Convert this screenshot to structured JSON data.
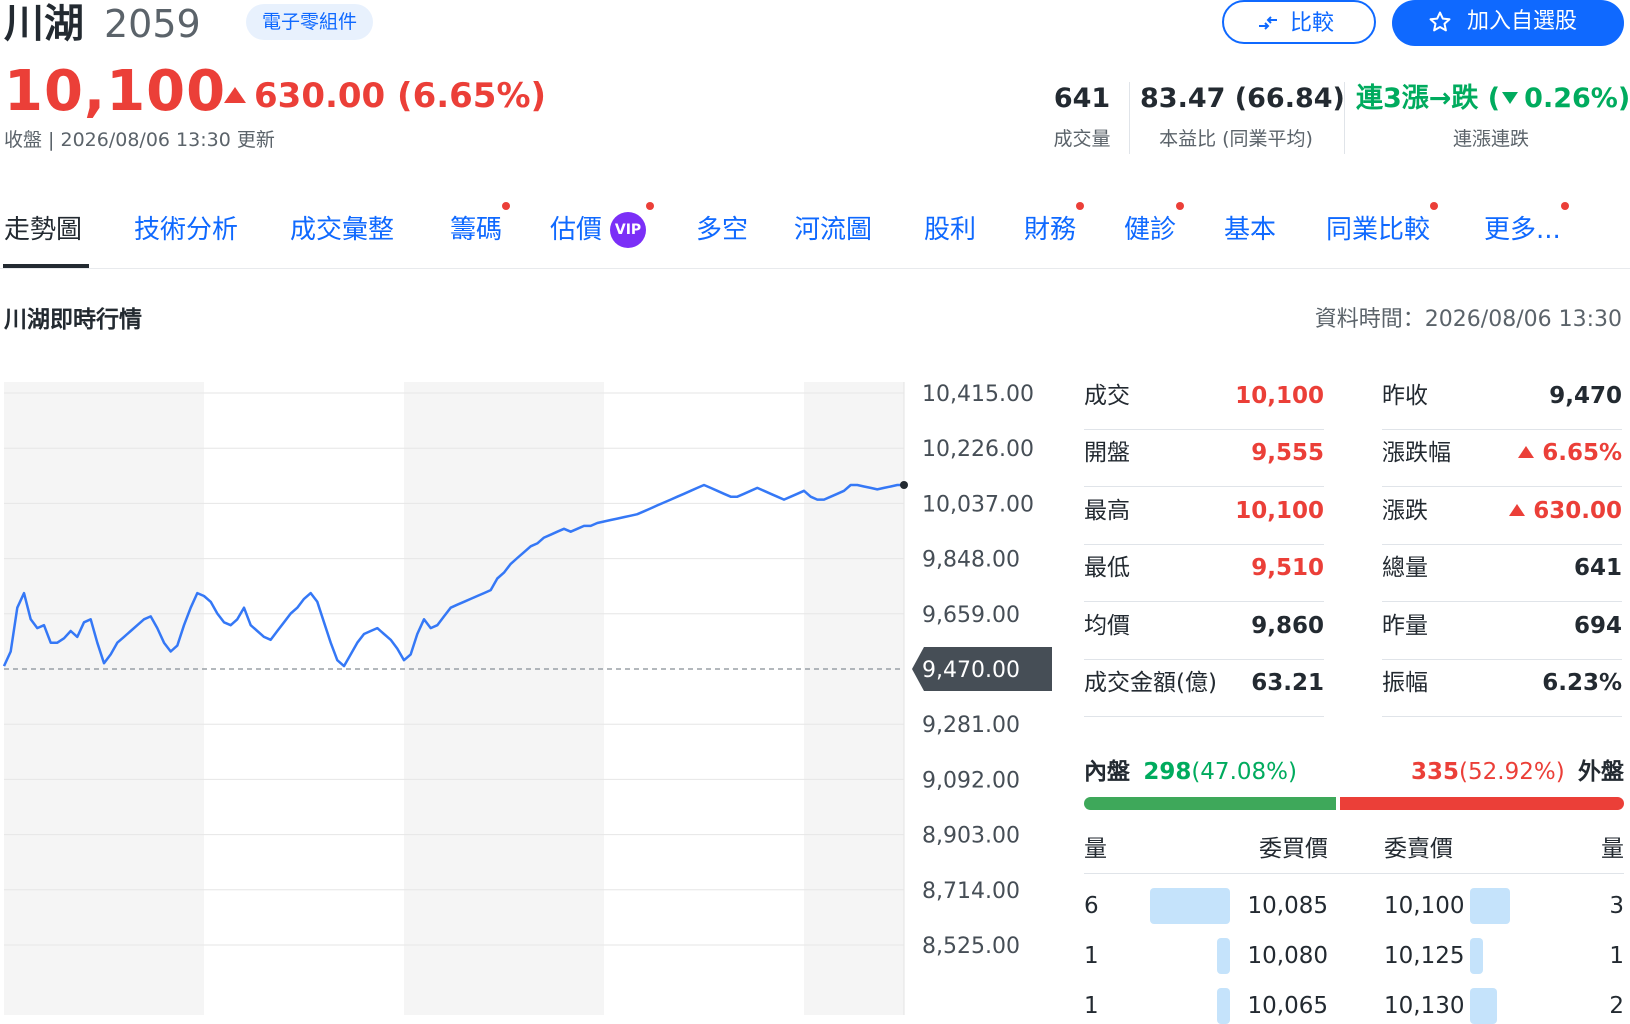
{
  "header": {
    "name": "川湖",
    "code": "2059",
    "industry": "電子零組件",
    "compare_label": "比較",
    "watchlist_label": "加入自選股",
    "price": "10,100",
    "change": "630.00 (6.65%)",
    "close_info": "收盤 | 2026/08/06 13:30 更新"
  },
  "stats": [
    {
      "value": "641",
      "label": "成交量"
    },
    {
      "value": "83.47 (66.84)",
      "label": "本益比 (同業平均)"
    },
    {
      "value_prefix": "連3漲→跌 (",
      "value_mid": "0.26%)",
      "label": "連漲連跌"
    }
  ],
  "tabs": [
    {
      "label": "走勢圖",
      "active": true,
      "dot": false
    },
    {
      "label": "技術分析",
      "dot": false
    },
    {
      "label": "成交彙整",
      "dot": false
    },
    {
      "label": "籌碼",
      "dot": true
    },
    {
      "label": "估價",
      "dot": true,
      "badge": "VIP"
    },
    {
      "label": "多空",
      "dot": false
    },
    {
      "label": "河流圖",
      "dot": false
    },
    {
      "label": "股利",
      "dot": false
    },
    {
      "label": "財務",
      "dot": true
    },
    {
      "label": "健診",
      "dot": true
    },
    {
      "label": "基本",
      "dot": false
    },
    {
      "label": "同業比較",
      "dot": true
    },
    {
      "label": "更多...",
      "dot": true
    }
  ],
  "section": {
    "title": "川湖即時行情",
    "data_time": "資料時間：2026/08/06 13:30"
  },
  "chart_data": {
    "type": "line",
    "y_ticks": [
      "10,415.00",
      "10,226.00",
      "10,037.00",
      "9,848.00",
      "9,659.00",
      "9,470.00",
      "9,281.00",
      "9,092.00",
      "8,903.00",
      "8,714.00",
      "8,525.00"
    ],
    "ylim": [
      8525,
      10415
    ],
    "reference_value": 9470,
    "reference_label": "9,470.00",
    "values": [
      9480,
      9530,
      9680,
      9730,
      9640,
      9610,
      9620,
      9560,
      9560,
      9575,
      9600,
      9580,
      9630,
      9640,
      9560,
      9490,
      9520,
      9560,
      9580,
      9600,
      9620,
      9640,
      9650,
      9610,
      9560,
      9530,
      9550,
      9620,
      9680,
      9730,
      9720,
      9700,
      9660,
      9630,
      9620,
      9640,
      9680,
      9620,
      9600,
      9580,
      9570,
      9600,
      9630,
      9660,
      9680,
      9710,
      9730,
      9700,
      9630,
      9560,
      9500,
      9480,
      9520,
      9560,
      9590,
      9600,
      9610,
      9590,
      9570,
      9540,
      9500,
      9520,
      9590,
      9640,
      9610,
      9620,
      9650,
      9680,
      9690,
      9700,
      9710,
      9720,
      9730,
      9740,
      9780,
      9800,
      9830,
      9850,
      9870,
      9890,
      9900,
      9920,
      9930,
      9940,
      9950,
      9940,
      9950,
      9960,
      9960,
      9970,
      9975,
      9980,
      9985,
      9990,
      9995,
      10000,
      10010,
      10020,
      10030,
      10040,
      10050,
      10060,
      10070,
      10080,
      10090,
      10100,
      10090,
      10080,
      10070,
      10060,
      10060,
      10070,
      10080,
      10090,
      10080,
      10070,
      10060,
      10050,
      10060,
      10070,
      10080,
      10060,
      10050,
      10050,
      10060,
      10070,
      10080,
      10100,
      10100,
      10095,
      10090,
      10085,
      10090,
      10095,
      10100,
      10100
    ],
    "total_slots": 270
  },
  "quote": {
    "left": [
      {
        "label": "成交",
        "value": "10,100",
        "color": "red"
      },
      {
        "label": "開盤",
        "value": "9,555",
        "color": "red"
      },
      {
        "label": "最高",
        "value": "10,100",
        "color": "red"
      },
      {
        "label": "最低",
        "value": "9,510",
        "color": "red"
      },
      {
        "label": "均價",
        "value": "9,860",
        "color": "dark"
      },
      {
        "label": "成交金額(億)",
        "value": "63.21",
        "color": "dark"
      }
    ],
    "right": [
      {
        "label": "昨收",
        "value": "9,470",
        "color": "dark"
      },
      {
        "label": "漲跌幅",
        "value": "6.65%",
        "color": "red",
        "arrow": true
      },
      {
        "label": "漲跌",
        "value": "630.00",
        "color": "red",
        "arrow": true
      },
      {
        "label": "總量",
        "value": "641",
        "color": "dark"
      },
      {
        "label": "昨量",
        "value": "694",
        "color": "dark"
      },
      {
        "label": "振幅",
        "value": "6.23%",
        "color": "dark"
      }
    ]
  },
  "inner_outer": {
    "inner_label": "內盤",
    "inner_value": "298",
    "inner_pct": "(47.08%)",
    "inner_fraction": 0.4708,
    "outer_value": "335",
    "outer_pct": "(52.92%)",
    "outer_label": "外盤"
  },
  "order_book": {
    "headers": [
      "量",
      "委買價",
      "委賣價",
      "量"
    ],
    "rows": [
      {
        "bid_qty": "6",
        "bid_price": "10,085",
        "ask_price": "10,100",
        "ask_qty": "3",
        "bid_fraction": 1.0,
        "ask_fraction": 0.5
      },
      {
        "bid_qty": "1",
        "bid_price": "10,080",
        "ask_price": "10,125",
        "ask_qty": "1",
        "bid_fraction": 0.167,
        "ask_fraction": 0.167
      },
      {
        "bid_qty": "1",
        "bid_price": "10,065",
        "ask_price": "10,130",
        "ask_qty": "2",
        "bid_fraction": 0.167,
        "ask_fraction": 0.333
      }
    ]
  },
  "colors": {
    "up": "#eb3f38",
    "down": "#00ab5e",
    "accent": "#0f69ff",
    "line": "#3578f6"
  }
}
